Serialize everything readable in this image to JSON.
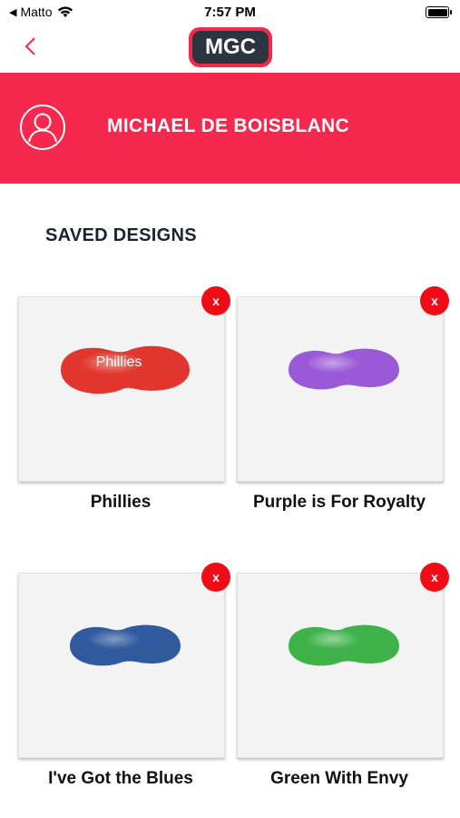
{
  "status_bar": {
    "carrier": "Matto",
    "time": "7:57 PM"
  },
  "nav": {
    "logo_text": "MGC"
  },
  "profile": {
    "name": "MICHAEL DE BOISBLANC"
  },
  "section_title": "SAVED DESIGNS",
  "designs": [
    {
      "name": "Phillies",
      "guard_text": "Phillies",
      "color": "#e0362d",
      "remove_label": "x"
    },
    {
      "name": "Purple is For Royalty",
      "guard_text": "",
      "color": "#9a59d6",
      "remove_label": "x"
    },
    {
      "name": "I've Got the Blues",
      "guard_text": "",
      "color": "#2f5a9e",
      "remove_label": "x"
    },
    {
      "name": "Green With Envy",
      "guard_text": "",
      "color": "#3fb24a",
      "remove_label": "x"
    }
  ],
  "colors": {
    "brand_red": "#f5284e",
    "navy": "#1b2237",
    "remove_red": "#f00c16"
  }
}
